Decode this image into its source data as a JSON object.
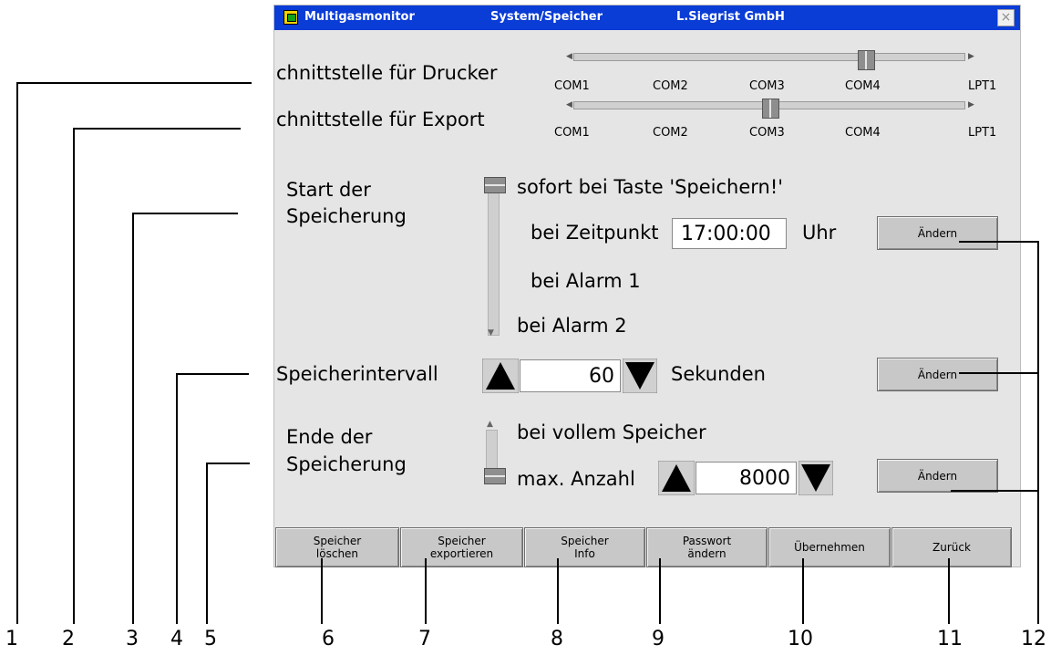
{
  "window": {
    "app_name": "Multigasmonitor",
    "section": "System/Speicher",
    "company": "L.Siegrist GmbH",
    "close_glyph": "×"
  },
  "printer_port": {
    "label": "chnittstelle für Drucker",
    "options": [
      "COM1",
      "COM2",
      "COM3",
      "COM4",
      "LPT1"
    ],
    "selected": "COM4"
  },
  "export_port": {
    "label": "chnittstelle für Export",
    "options": [
      "COM1",
      "COM2",
      "COM3",
      "COM4",
      "LPT1"
    ],
    "selected": "COM3"
  },
  "start": {
    "label_line1": "Start der",
    "label_line2": "Speicherung",
    "options": [
      "sofort bei Taste 'Speichern!'",
      "bei Zeitpunkt",
      "bei Alarm 1",
      "bei Alarm 2"
    ],
    "selected": "sofort bei Taste 'Speichern!'",
    "time_value": "17:00:00",
    "time_unit": "Uhr",
    "change_label": "Ändern"
  },
  "interval": {
    "label": "Speicherintervall",
    "value": "60",
    "unit": "Sekunden",
    "change_label": "Ändern"
  },
  "end": {
    "label_line1": "Ende der",
    "label_line2": "Speicherung",
    "options": [
      "bei vollem Speicher",
      "max. Anzahl"
    ],
    "selected": "max. Anzahl",
    "max_value": "8000",
    "change_label": "Ändern"
  },
  "bottom_buttons": [
    "Speicher\nlöschen",
    "Speicher\nexportieren",
    "Speicher\nInfo",
    "Passwort\nändern",
    "Übernehmen",
    "Zurück"
  ],
  "callouts": [
    "1",
    "2",
    "3",
    "4",
    "5",
    "6",
    "7",
    "8",
    "9",
    "10",
    "11",
    "12"
  ],
  "colors": {
    "titlebar": "#0a3cd6",
    "window_bg": "#e5e5e5",
    "button_bg": "#c8c8c8"
  },
  "icons": [
    "app-icon",
    "close-icon",
    "up-arrow-icon",
    "down-arrow-icon",
    "left-arrow-icon",
    "right-arrow-icon"
  ]
}
